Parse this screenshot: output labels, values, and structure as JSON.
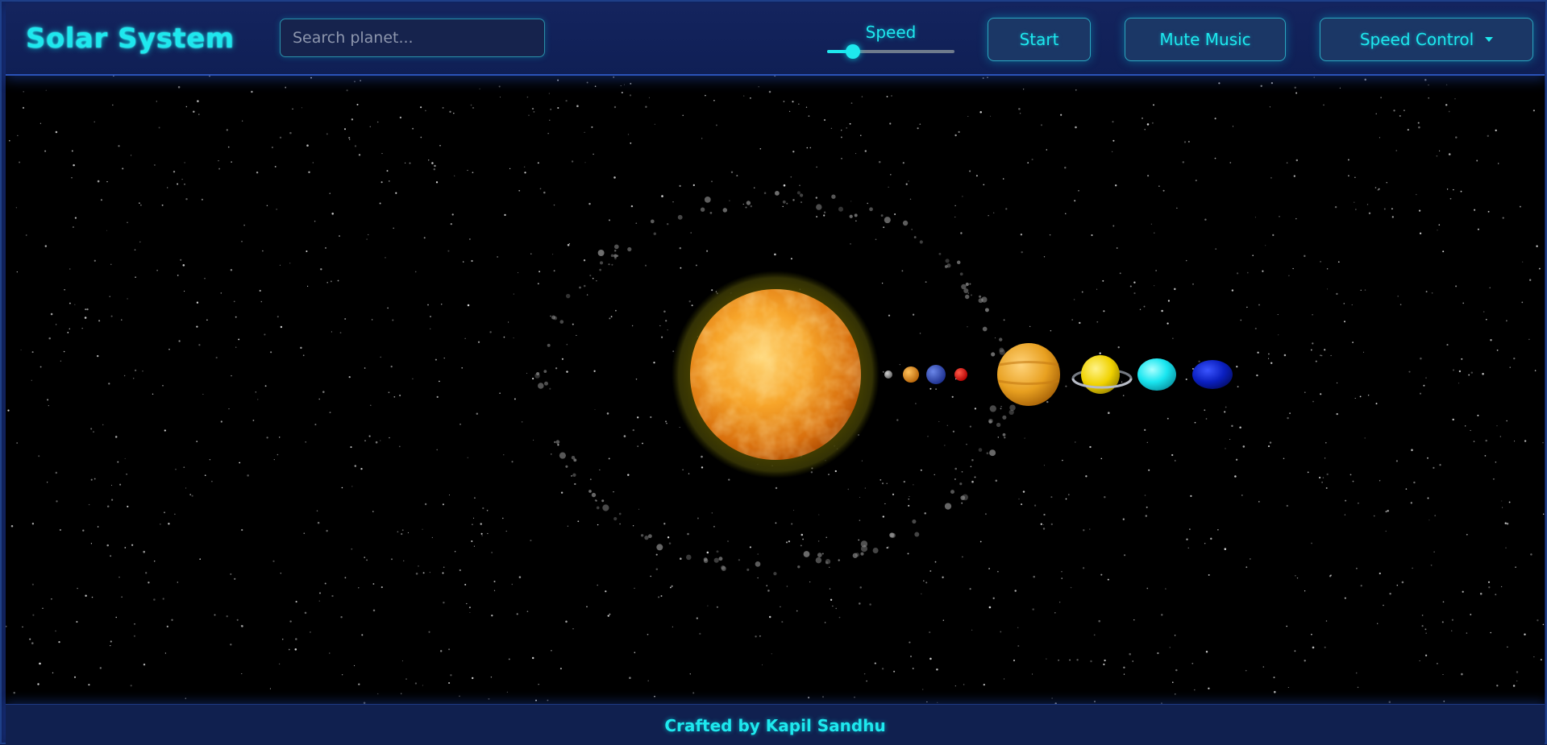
{
  "header": {
    "title": "Solar System",
    "search": {
      "placeholder": "Search planet...",
      "value": ""
    },
    "speed": {
      "label": "Speed",
      "value_fraction": 0.2
    },
    "buttons": {
      "start": "Start",
      "mute": "Mute Music",
      "speed_control": "Speed Control"
    }
  },
  "scene": {
    "sun": {
      "name": "sun",
      "color": "#f5a623"
    },
    "planets": [
      {
        "name": "mercury",
        "color": "#9a9a9a"
      },
      {
        "name": "venus",
        "color": "#e08a18"
      },
      {
        "name": "earth",
        "color": "#2f4bbf"
      },
      {
        "name": "mars",
        "color": "#e60000"
      },
      {
        "name": "jupiter",
        "color": "#e8a020"
      },
      {
        "name": "saturn",
        "color": "#f0d200"
      },
      {
        "name": "uranus",
        "color": "#19e6f0"
      },
      {
        "name": "neptune",
        "color": "#0a1fbf"
      }
    ]
  },
  "footer": {
    "credit": "Crafted by Kapil Sandhu"
  },
  "colors": {
    "accent": "#1ee8ee",
    "header_bg": "#10215a",
    "space_bg": "#000000"
  }
}
